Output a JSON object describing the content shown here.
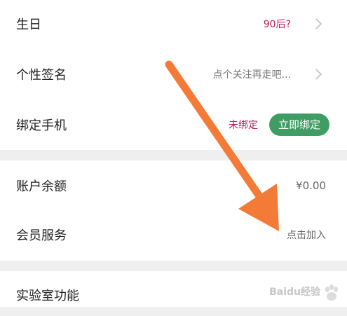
{
  "settings": {
    "birthday": {
      "label": "生日",
      "value": "90后?"
    },
    "signature": {
      "label": "个性签名",
      "value": "点个关注再走吧..."
    },
    "phone": {
      "label": "绑定手机",
      "status": "未绑定",
      "button": "立即绑定"
    },
    "balance": {
      "label": "账户余额",
      "value": "¥0.00"
    },
    "membership": {
      "label": "会员服务",
      "value": "点击加入"
    },
    "lab": {
      "label": "实验室功能"
    }
  },
  "watermark": {
    "text": "Baidu经验"
  },
  "colors": {
    "accent_value": "#c2185b",
    "button_green": "#3f9d63",
    "arrow_orange": "#f47a37",
    "section_gap": "#efefef"
  },
  "icons": {
    "chevron": "chevron-right-icon",
    "annotation": "orange-pointer-arrow-icon",
    "watermark": "baidu-paw-logo"
  }
}
